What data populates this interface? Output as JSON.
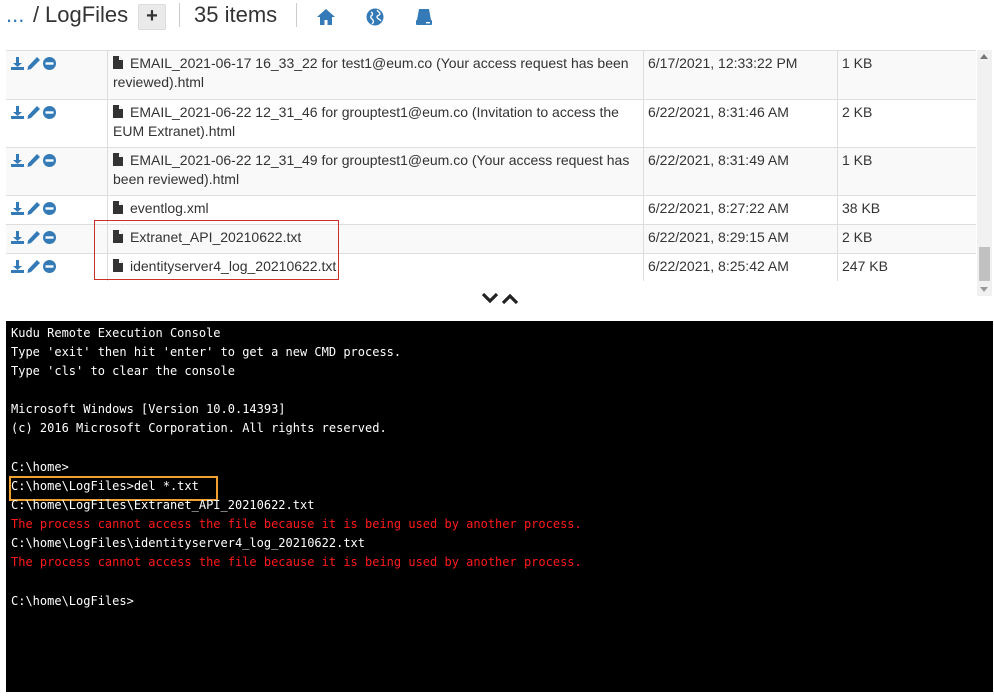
{
  "header": {
    "breadcrumb_ellipsis": "...",
    "breadcrumb_separator": "/",
    "current_directory": "LogFiles",
    "add_label": "+",
    "item_count": "35 items",
    "icons": [
      "home-icon",
      "globe-icon",
      "drive-icon"
    ]
  },
  "file_list": {
    "row_actions": [
      "download-icon",
      "edit-icon",
      "delete-icon"
    ],
    "rows": [
      {
        "name": "EMAIL_2021-06-17 16_33_22 for test1@eum.co (Your access request has been reviewed).html",
        "modified": "6/17/2021, 12:33:22 PM",
        "size": "1 KB"
      },
      {
        "name": "EMAIL_2021-06-22 12_31_46 for grouptest1@eum.co (Invitation to access the EUM Extranet).html",
        "modified": "6/22/2021, 8:31:46 AM",
        "size": "2 KB"
      },
      {
        "name": "EMAIL_2021-06-22 12_31_49 for grouptest1@eum.co (Your access request has been reviewed).html",
        "modified": "6/22/2021, 8:31:49 AM",
        "size": "1 KB"
      },
      {
        "name": "eventlog.xml",
        "modified": "6/22/2021, 8:27:22 AM",
        "size": "38 KB"
      },
      {
        "name": "Extranet_API_20210622.txt",
        "modified": "6/22/2021, 8:29:15 AM",
        "size": "2 KB"
      },
      {
        "name": "identityserver4_log_20210622.txt",
        "modified": "6/22/2021, 8:25:42 AM",
        "size": "247 KB"
      }
    ]
  },
  "console": {
    "lines": [
      {
        "text": "Kudu Remote Execution Console",
        "type": "normal"
      },
      {
        "text": "Type 'exit' then hit 'enter' to get a new CMD process.",
        "type": "normal"
      },
      {
        "text": "Type 'cls' to clear the console",
        "type": "normal"
      },
      {
        "text": "",
        "type": "normal"
      },
      {
        "text": "Microsoft Windows [Version 10.0.14393]",
        "type": "normal"
      },
      {
        "text": "(c) 2016 Microsoft Corporation. All rights reserved.",
        "type": "normal"
      },
      {
        "text": "",
        "type": "normal"
      },
      {
        "text": "C:\\home>",
        "type": "normal"
      },
      {
        "text": "C:\\home\\LogFiles>del *.txt",
        "type": "normal"
      },
      {
        "text": "C:\\home\\LogFiles\\Extranet_API_20210622.txt",
        "type": "normal"
      },
      {
        "text": "The process cannot access the file because it is being used by another process.",
        "type": "error"
      },
      {
        "text": "C:\\home\\LogFiles\\identityserver4_log_20210622.txt",
        "type": "normal"
      },
      {
        "text": "The process cannot access the file because it is being used by another process.",
        "type": "error"
      },
      {
        "text": "",
        "type": "normal"
      },
      {
        "text": "C:\\home\\LogFiles>",
        "type": "normal"
      }
    ]
  },
  "colors": {
    "link_blue": "#337ab7",
    "icon_blue": "#337ab7",
    "error_red": "#ff1a1a",
    "highlight_orange": "#f0a030",
    "file_box_red": "#c9302c"
  }
}
